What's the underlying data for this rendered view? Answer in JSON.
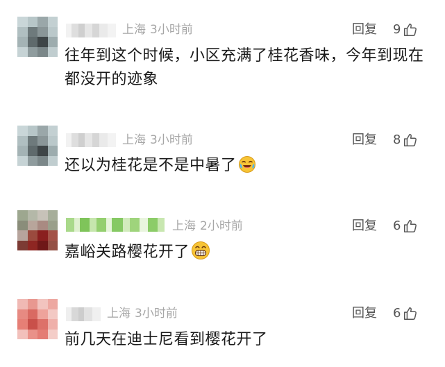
{
  "comments": [
    {
      "location": "上海",
      "time": "3小时前",
      "reply_label": "回复",
      "likes": "9",
      "text": "往年到这个时候，小区充满了桂花香味，今年到现在都没开的迹象"
    },
    {
      "location": "上海",
      "time": "3小时前",
      "reply_label": "回复",
      "likes": "8",
      "text": "还以为桂花是不是中暑了",
      "emoji": "laughing-crying-emoji"
    },
    {
      "location": "上海",
      "time": "2小时前",
      "reply_label": "回复",
      "likes": "6",
      "text": "嘉峪关路樱花开了",
      "emoji": "grinning-emoji"
    },
    {
      "location": "上海",
      "time": "3小时前",
      "reply_label": "回复",
      "likes": "6",
      "text": "前几天在迪士尼看到樱花开了"
    }
  ],
  "colors": {
    "meta": "#a6a6a6",
    "text": "#1a1a1a",
    "action": "#555555"
  }
}
